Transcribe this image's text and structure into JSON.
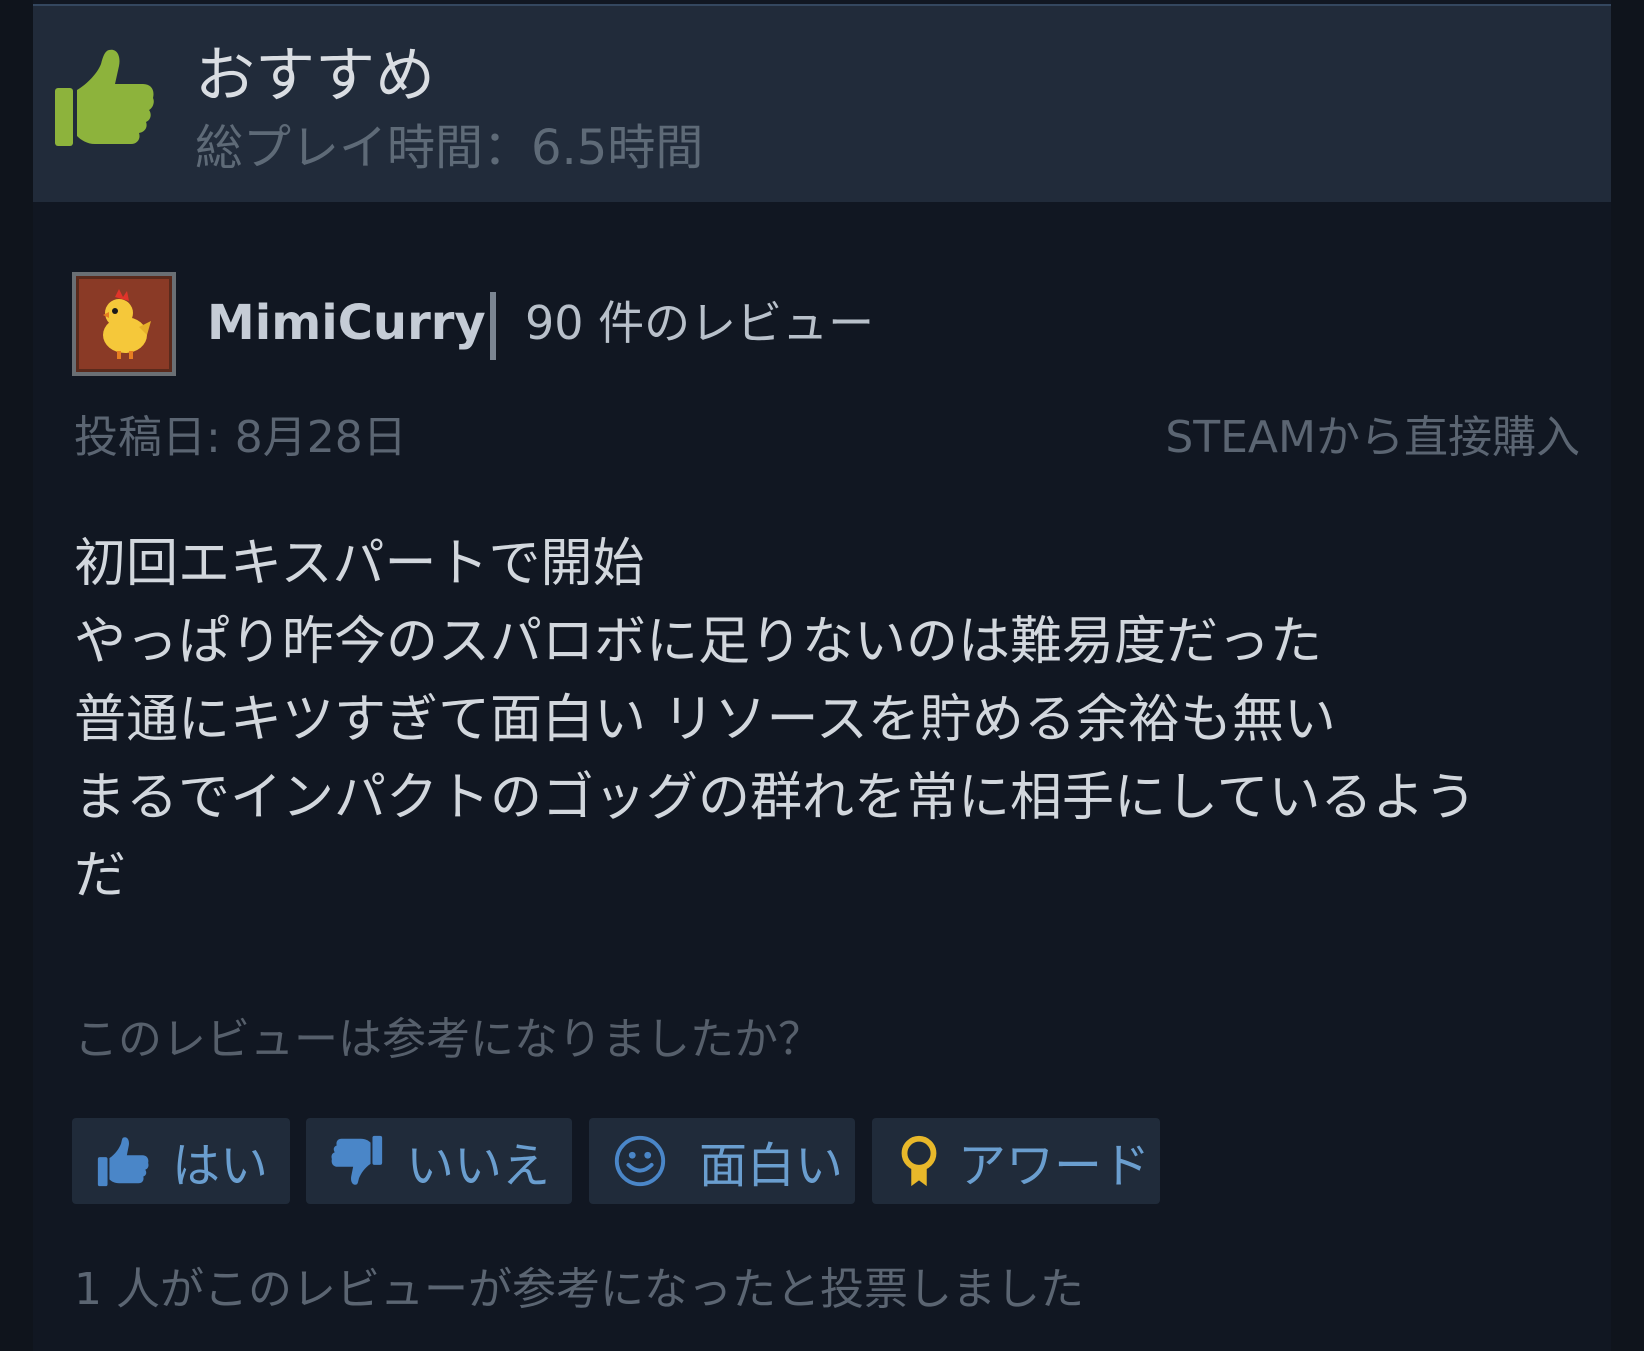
{
  "header": {
    "recommendation": "おすすめ",
    "playtime": "総プレイ時間：6.5時間",
    "icon": "thumbs-up-icon",
    "icon_color": "#8db33c"
  },
  "author": {
    "name": "MimiCurry",
    "review_count": "90 件のレビュー",
    "avatar": "chicken-avatar"
  },
  "meta": {
    "posted": "投稿日: 8月28日",
    "source": "STEAMから直接購入"
  },
  "review": {
    "lines": [
      "初回エキスパートで開始",
      "やっぱり昨今のスパロボに足りないのは難易度だった",
      "普通にキツすぎて面白い リソースを貯める余裕も無い",
      "まるでインパクトのゴッグの群れを常に相手にしているよう",
      "だ"
    ]
  },
  "helpful": {
    "question": "このレビューは参考になりましたか？",
    "buttons": {
      "yes": "はい",
      "no": "いいえ",
      "funny": "面白い",
      "award": "アワード"
    },
    "votes": "1 人がこのレビューが参考になったと投票しました"
  },
  "colors": {
    "background": "#111722",
    "header_bg": "#212b3a",
    "button_bg": "#202b3a",
    "button_text": "#6a9ecf",
    "award_gold": "#e8b82a"
  }
}
